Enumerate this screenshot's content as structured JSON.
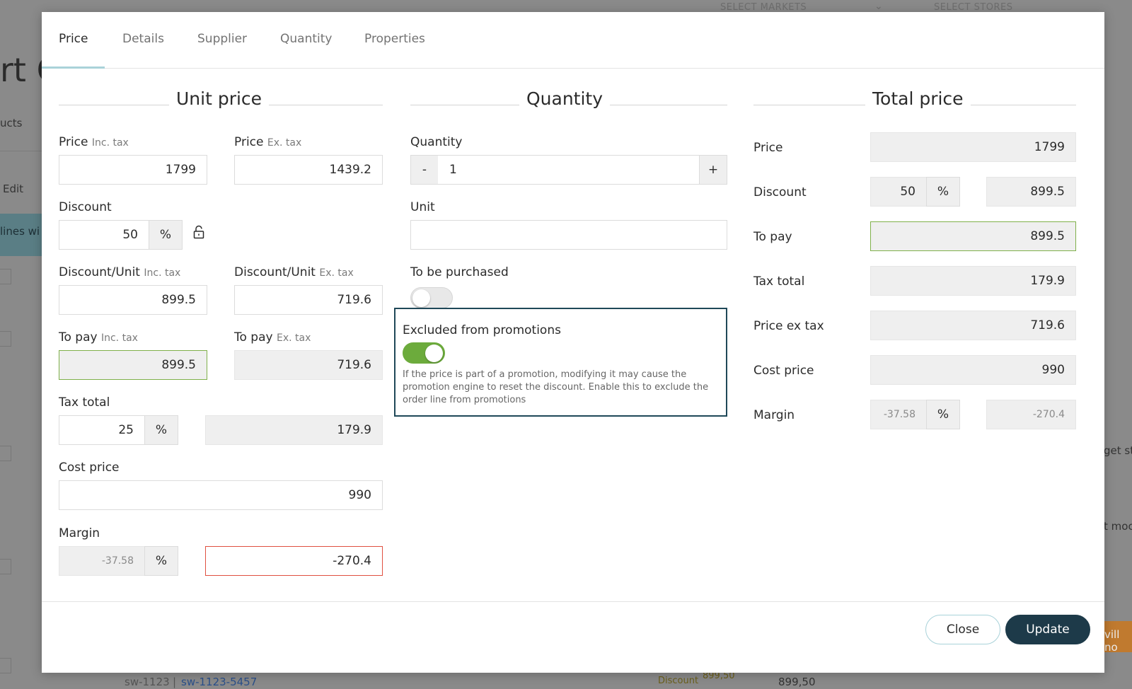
{
  "background": {
    "select_markets": "SELECT MARKETS",
    "select_stores": "SELECT STORES",
    "title_fragment": "rt C",
    "products_fragment": "ucts",
    "edit_label": "Edit",
    "lines_fragment": "lines wi",
    "get_fragment": "get st",
    "mod_fragment": "t moc",
    "will_fragment": "vill no",
    "sku": "sw-1123",
    "sku_variant": "sw-1123-5457",
    "discount_label": "Discount",
    "discount_value": "899,50",
    "line_price": "899,50"
  },
  "tabs": [
    {
      "label": "Price",
      "active": true
    },
    {
      "label": "Details"
    },
    {
      "label": "Supplier"
    },
    {
      "label": "Quantity"
    },
    {
      "label": "Properties"
    }
  ],
  "unit_price": {
    "title": "Unit price",
    "price_label": "Price",
    "inc_tax": "Inc. tax",
    "ex_tax": "Ex. tax",
    "price_inc": "1799",
    "price_ex": "1439.2",
    "discount_label": "Discount",
    "discount_value": "50",
    "discount_unit": "%",
    "discount_unit_label": "Discount/Unit",
    "discount_unit_inc": "899.5",
    "discount_unit_ex": "719.6",
    "to_pay_label": "To pay",
    "to_pay_inc": "899.5",
    "to_pay_ex": "719.6",
    "tax_total_label": "Tax total",
    "tax_percent": "25",
    "tax_unit": "%",
    "tax_amount": "179.9",
    "cost_price_label": "Cost price",
    "cost_price": "990",
    "margin_label": "Margin",
    "margin_percent": "-37.58",
    "margin_unit": "%",
    "margin_amount": "-270.4"
  },
  "quantity": {
    "title": "Quantity",
    "quantity_label": "Quantity",
    "minus": "-",
    "plus": "+",
    "value": "1",
    "unit_label": "Unit",
    "unit_value": "",
    "to_be_purchased_label": "To be purchased",
    "to_be_purchased": false,
    "excluded_label": "Excluded from promotions",
    "excluded": true,
    "excluded_help": "If the price is part of a promotion, modifying it may cause the promotion engine to reset the discount. Enable this to exclude the order line from promotions"
  },
  "total_price": {
    "title": "Total price",
    "price_label": "Price",
    "price": "1799",
    "discount_label": "Discount",
    "discount_percent": "50",
    "discount_unit": "%",
    "discount_amount": "899.5",
    "to_pay_label": "To pay",
    "to_pay": "899.5",
    "tax_total_label": "Tax total",
    "tax_total": "179.9",
    "price_ex_tax_label": "Price ex tax",
    "price_ex_tax": "719.6",
    "cost_price_label": "Cost price",
    "cost_price": "990",
    "margin_label": "Margin",
    "margin_percent": "-37.58",
    "margin_unit": "%",
    "margin_amount": "-270.4"
  },
  "footer": {
    "close_label": "Close",
    "update_label": "Update"
  },
  "colors": {
    "accent_dark": "#1d3a49",
    "toggle_on": "#6cab3c",
    "error_border": "#e05040",
    "success_border": "#7fb04a"
  }
}
